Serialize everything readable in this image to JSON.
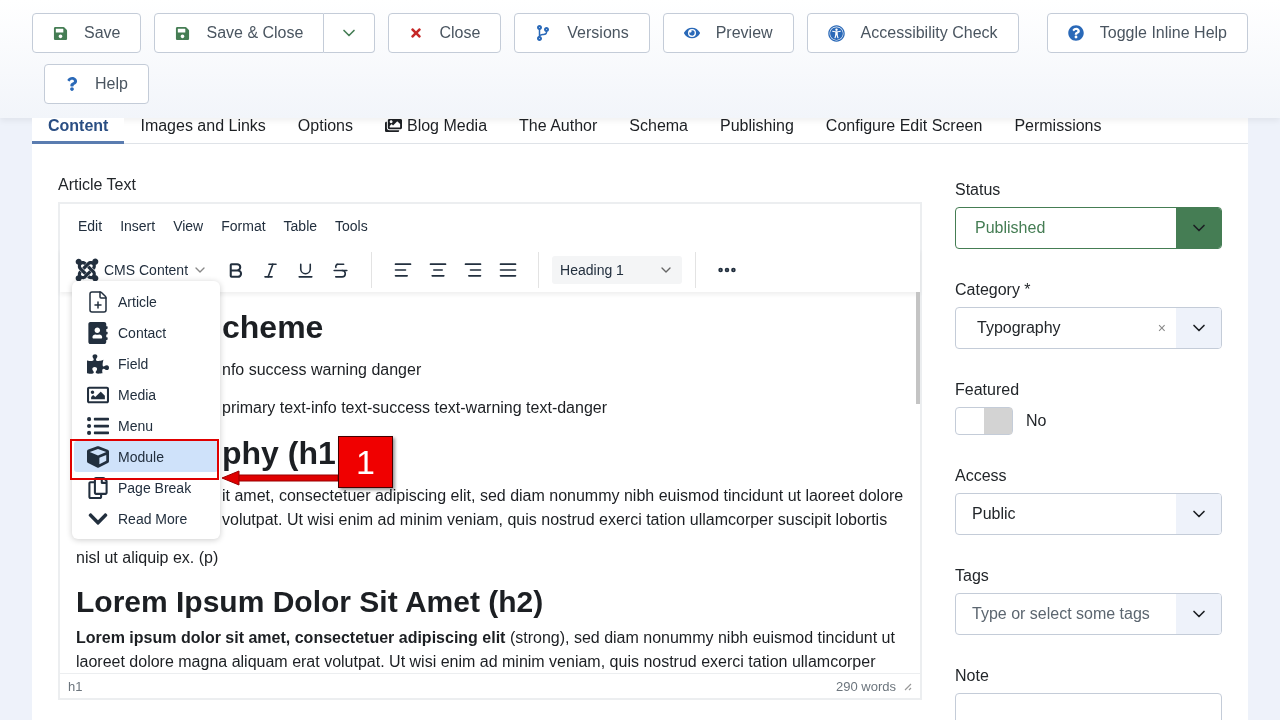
{
  "toolbar": {
    "buttons": [
      {
        "label": "Save",
        "kind": "plain"
      },
      {
        "label": "Save & Close",
        "kind": "split"
      },
      {
        "label": "Close",
        "kind": "plain"
      },
      {
        "label": "Versions",
        "kind": "plain"
      },
      {
        "label": "Preview",
        "kind": "plain"
      },
      {
        "label": "Accessibility Check",
        "kind": "plain"
      }
    ],
    "right_button": "Toggle Inline Help",
    "second_row_button": "Help"
  },
  "tabs": [
    {
      "label": "Content",
      "selected": true
    },
    {
      "label": "Images and Links",
      "selected": false
    },
    {
      "label": "Options",
      "selected": false
    },
    {
      "label": "Blog Media",
      "selected": false,
      "kind": "icon"
    },
    {
      "label": "The Author",
      "selected": false
    },
    {
      "label": "Schema",
      "selected": false
    },
    {
      "label": "Publishing",
      "selected": false
    },
    {
      "label": "Configure Edit Screen",
      "selected": false
    },
    {
      "label": "Permissions",
      "selected": false
    }
  ],
  "editor": {
    "label": "Article Text",
    "menubar": [
      "Edit",
      "Insert",
      "View",
      "Format",
      "Table",
      "Tools"
    ],
    "cms_button": "CMS Content",
    "block_format": "Heading 1",
    "cms_menu": [
      {
        "label": "Article",
        "selected": false
      },
      {
        "label": "Contact",
        "selected": false
      },
      {
        "label": "Field",
        "selected": false
      },
      {
        "label": "Media",
        "selected": false
      },
      {
        "label": "Menu",
        "selected": false
      },
      {
        "label": "Module",
        "selected": true
      },
      {
        "label": "Page Break",
        "selected": false
      },
      {
        "label": "Read More",
        "selected": false
      }
    ],
    "content_beside_menu": [
      {
        "kind": "h1",
        "text": "cheme"
      },
      {
        "kind": "p",
        "text": "nfo success warning danger"
      },
      {
        "kind": "p",
        "text": "primary text-info text-success text-warning text-danger"
      },
      {
        "kind": "h1",
        "text": "phy (h1"
      },
      {
        "kind": "line",
        "text": "it amet, consectetuer adipiscing elit, sed diam nonummy nibh euismod tincidunt ut laoreet dolore"
      },
      {
        "kind": "line",
        "text": "volutpat. Ut wisi enim ad minim veniam, quis nostrud exerci tation ullamcorper suscipit lobortis"
      }
    ],
    "content": [
      {
        "kind": "p",
        "text": "nisl ut aliquip ex. (p)"
      },
      {
        "kind": "h2",
        "text": "Lorem Ipsum Dolor Sit Amet (h2)"
      },
      {
        "kind": "p",
        "text": "**Lorem ipsum dolor sit amet, consectetuer adipiscing elit** (strong), sed diam nonummy nibh euismod tincidunt ut laoreet dolore magna aliquam erat volutpat. Ut wisi enim ad minim veniam, quis nostrud exerci tation ullamcorper"
      }
    ],
    "status_path": "h1",
    "word_count": "290 words"
  },
  "annotation": {
    "number": "1"
  },
  "sidebar": {
    "status": {
      "label": "Status",
      "value": "Published"
    },
    "category": {
      "label": "Category *",
      "value": "Typography",
      "clear": "×"
    },
    "featured": {
      "label": "Featured",
      "on": false,
      "state_label": "No"
    },
    "access": {
      "label": "Access",
      "value": "Public"
    },
    "tags": {
      "label": "Tags",
      "placeholder": "Type or select some tags"
    },
    "note": {
      "label": "Note"
    }
  }
}
